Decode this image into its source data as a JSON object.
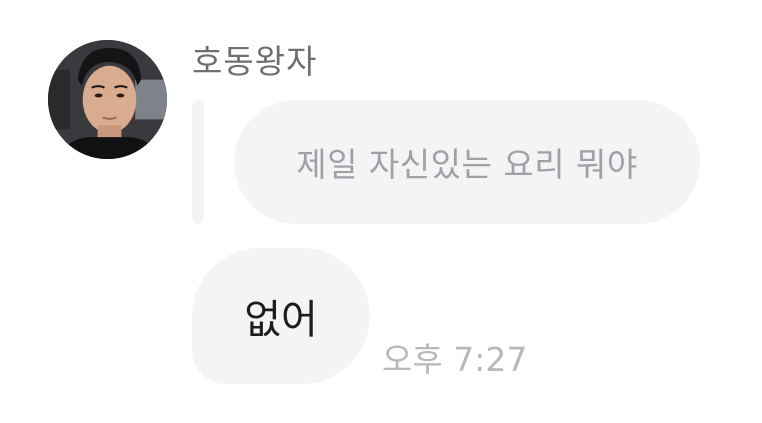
{
  "sender": {
    "name": "호동왕자",
    "avatar_icon": "profile-photo-avatar"
  },
  "reply": {
    "quoted_text": "제일 자신있는 요리 뭐야"
  },
  "message": {
    "text": "없어",
    "timestamp": "오후 7:27"
  },
  "colors": {
    "bubble": "#f4f4f6",
    "sender_name": "#6f6f73",
    "quoted_text": "#a0a0a5",
    "message_text": "#1d1d1f",
    "timestamp": "#b8b8bc"
  }
}
